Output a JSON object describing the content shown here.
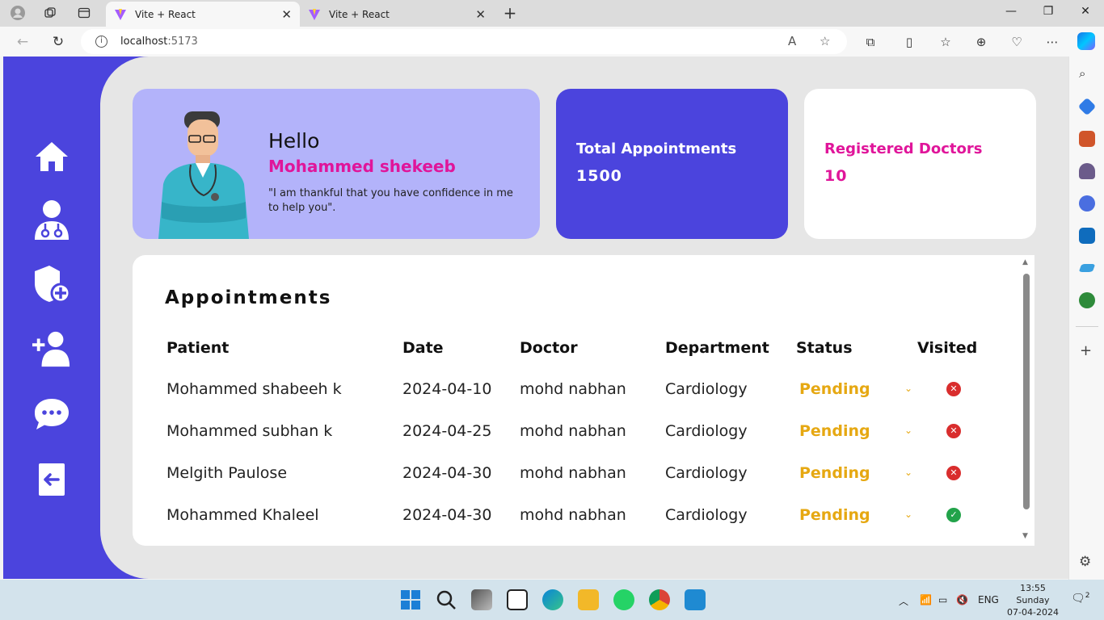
{
  "browser": {
    "tabs": [
      {
        "title": "Vite + React",
        "active": true
      },
      {
        "title": "Vite + React",
        "active": false
      }
    ],
    "url_host": "localhost",
    "url_port": ":5173"
  },
  "sidebar": {
    "items": [
      "home-icon",
      "doctor-icon",
      "shield-plus-icon",
      "add-user-icon",
      "chat-icon",
      "logout-icon"
    ]
  },
  "greeting": {
    "hello": "Hello",
    "name": "Mohammed shekeeb",
    "quote": "\"I am thankful that you have confidence in me to help you\"."
  },
  "stats": {
    "appointments_label": "Total Appointments",
    "appointments_value": "1500",
    "doctors_label": "Registered Doctors",
    "doctors_value": "10"
  },
  "appointments": {
    "title": "Appointments",
    "headers": [
      "Patient",
      "Date",
      "Doctor",
      "Department",
      "Status",
      "Visited"
    ],
    "rows": [
      {
        "patient": "Mohammed shabeeh k",
        "date": "2024-04-10",
        "doctor": "mohd nabhan",
        "department": "Cardiology",
        "status": "Pending",
        "visited": false
      },
      {
        "patient": "Mohammed subhan k",
        "date": "2024-04-25",
        "doctor": "mohd nabhan",
        "department": "Cardiology",
        "status": "Pending",
        "visited": false
      },
      {
        "patient": "Melgith Paulose",
        "date": "2024-04-30",
        "doctor": "mohd nabhan",
        "department": "Cardiology",
        "status": "Pending",
        "visited": false
      },
      {
        "patient": "Mohammed Khaleel",
        "date": "2024-04-30",
        "doctor": "mohd nabhan",
        "department": "Cardiology",
        "status": "Pending",
        "visited": true
      }
    ]
  },
  "taskbar": {
    "language": "ENG",
    "time": "13:55",
    "day": "Sunday",
    "date": "07-04-2024",
    "notifications": "2"
  },
  "colors": {
    "primary": "#4b44dd",
    "accent": "#e0159a",
    "pending": "#e6a812",
    "hello_card": "#b3b3fa"
  }
}
